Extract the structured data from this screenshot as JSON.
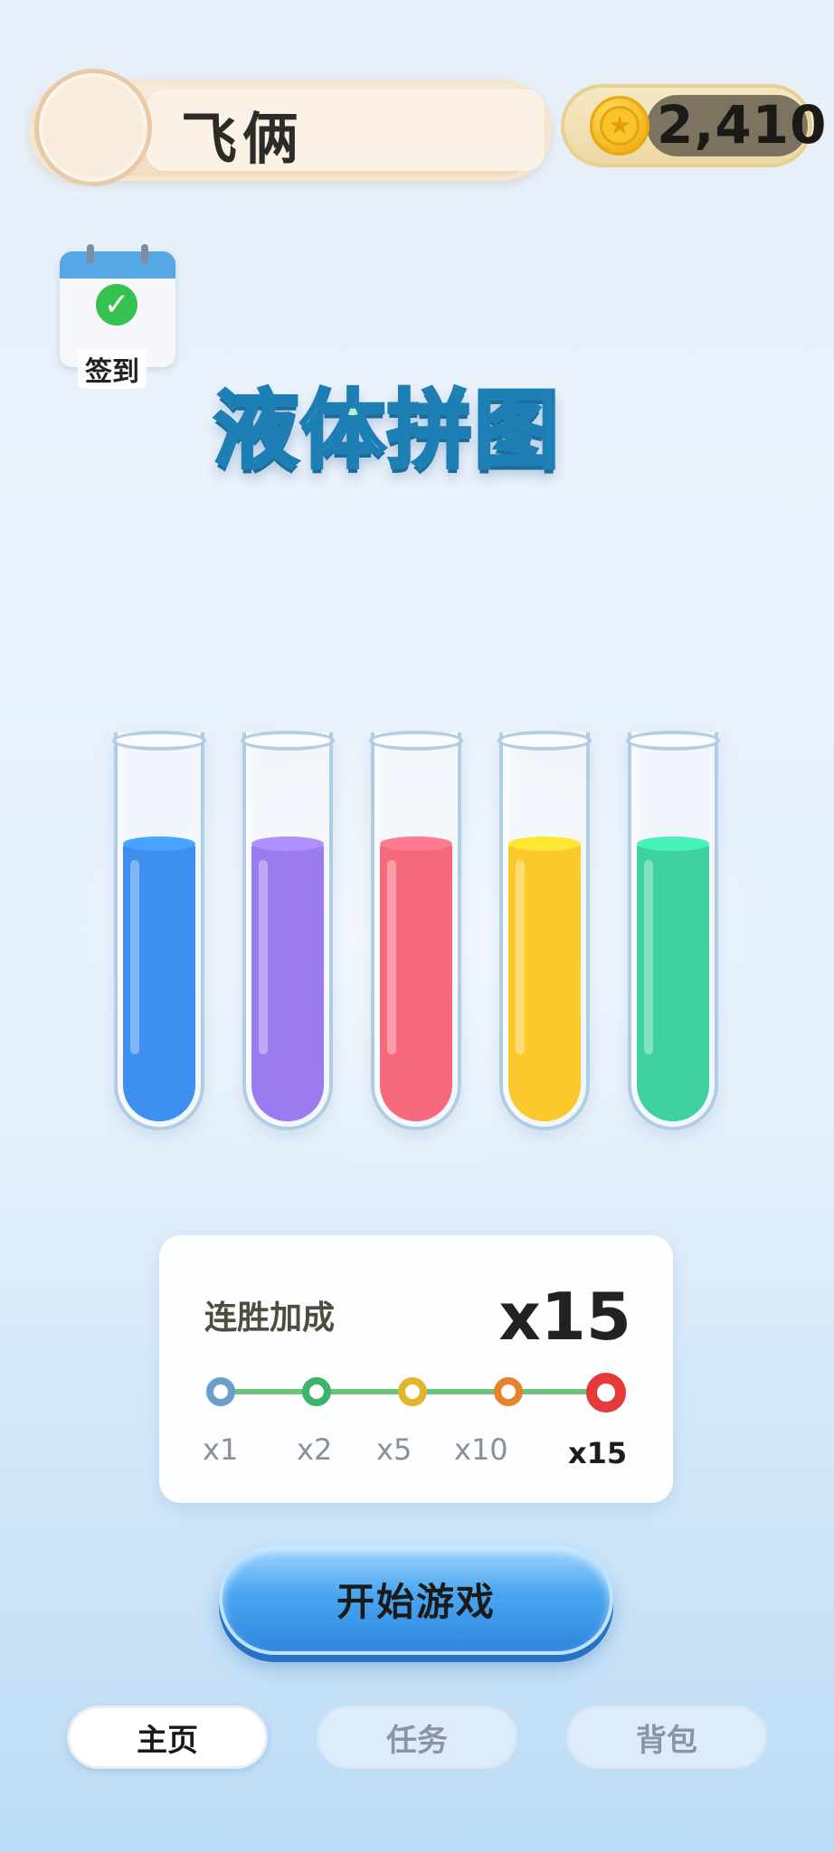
{
  "header": {
    "username": "飞俩",
    "coins": "2,410"
  },
  "checkin": {
    "label": "签到"
  },
  "game": {
    "title_chars": [
      "液",
      "体",
      "拼",
      "图"
    ]
  },
  "tubes": [
    {
      "color": "#3d8ff0",
      "fill": 0.73
    },
    {
      "color": "#9b7cf0",
      "fill": 0.73
    },
    {
      "color": "#f46a7c",
      "fill": 0.73
    },
    {
      "color": "#fbc92c",
      "fill": 0.73
    },
    {
      "color": "#3fd2a0",
      "fill": 0.73
    }
  ],
  "streak": {
    "label": "连胜加成",
    "value": "x15",
    "steps": [
      {
        "label": "x1",
        "color": "#6b9fc9"
      },
      {
        "label": "x2",
        "color": "#3db36b"
      },
      {
        "label": "x5",
        "color": "#e2b52e"
      },
      {
        "label": "x10",
        "color": "#e8822e"
      },
      {
        "label": "x15",
        "color": "#e53a3a"
      }
    ]
  },
  "start_button": {
    "label": "开始游戏"
  },
  "nav": {
    "home": "主页",
    "tasks": "任务",
    "bag": "背包"
  }
}
